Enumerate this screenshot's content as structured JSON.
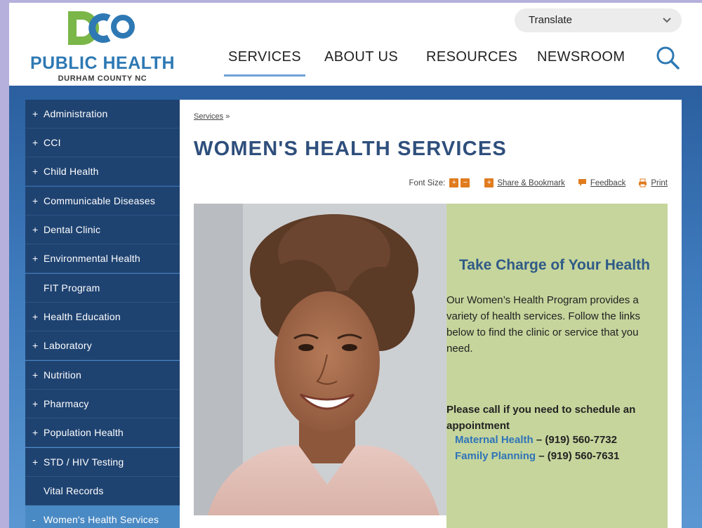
{
  "header": {
    "logo_letters": "DCO",
    "logo_line1": "PUBLIC HEALTH",
    "logo_line2": "DURHAM COUNTY NC",
    "translate_label": "Translate",
    "translate_icon": "chevron-down-icon",
    "nav": [
      "SERVICES",
      "ABOUT US",
      "RESOURCES",
      "NEWSROOM"
    ],
    "active_nav": "SERVICES",
    "search_icon": "search-icon"
  },
  "sidebar": {
    "items": [
      {
        "prefix": "+",
        "label": "Administration"
      },
      {
        "prefix": "+",
        "label": "CCI"
      },
      {
        "prefix": "+",
        "label": "Child Health"
      },
      {
        "prefix": "+",
        "label": "Communicable Diseases"
      },
      {
        "prefix": "+",
        "label": "Dental Clinic"
      },
      {
        "prefix": "+",
        "label": "Environmental Health"
      },
      {
        "prefix": "",
        "label": "FIT Program"
      },
      {
        "prefix": "+",
        "label": "Health Education"
      },
      {
        "prefix": "+",
        "label": "Laboratory"
      },
      {
        "prefix": "+",
        "label": "Nutrition"
      },
      {
        "prefix": "+",
        "label": "Pharmacy"
      },
      {
        "prefix": "+",
        "label": "Population Health"
      },
      {
        "prefix": "+",
        "label": "STD / HIV Testing"
      },
      {
        "prefix": "",
        "label": "Vital Records"
      },
      {
        "prefix": "-",
        "label": "Women's Health Services"
      }
    ],
    "active_label": "Women's Health Services"
  },
  "main": {
    "breadcrumb_link": "Services",
    "breadcrumb_sep": "»",
    "title": "WOMEN'S HEALTH SERVICES",
    "tools": {
      "font_size_label": "Font Size:",
      "font_plus": "+",
      "font_minus": "−",
      "share_label": "Share & Bookmark",
      "feedback_label": "Feedback",
      "print_label": "Print"
    },
    "box": {
      "heading": "Take Charge of Your Health",
      "body": "Our Women’s Health Program provides a variety of health services.  Follow the links below to find the clinic or service that you need.",
      "call": "Please call if you need to schedule an appointment",
      "contacts": [
        {
          "name": "Maternal Health",
          "sep": " – ",
          "phone": "(919) 560-7732"
        },
        {
          "name": "Family Planning",
          "sep": " – ",
          "phone": "(919) 560-7631"
        }
      ]
    }
  },
  "colors": {
    "brand_blue": "#2e79b4",
    "logo_green": "#7ab648",
    "sidebar_bg": "#1f4371",
    "sidebar_active": "#4a8ac4",
    "title_color": "#2f4f7c",
    "box_bg": "#c6d59c",
    "accent_orange": "#e07b1e"
  }
}
